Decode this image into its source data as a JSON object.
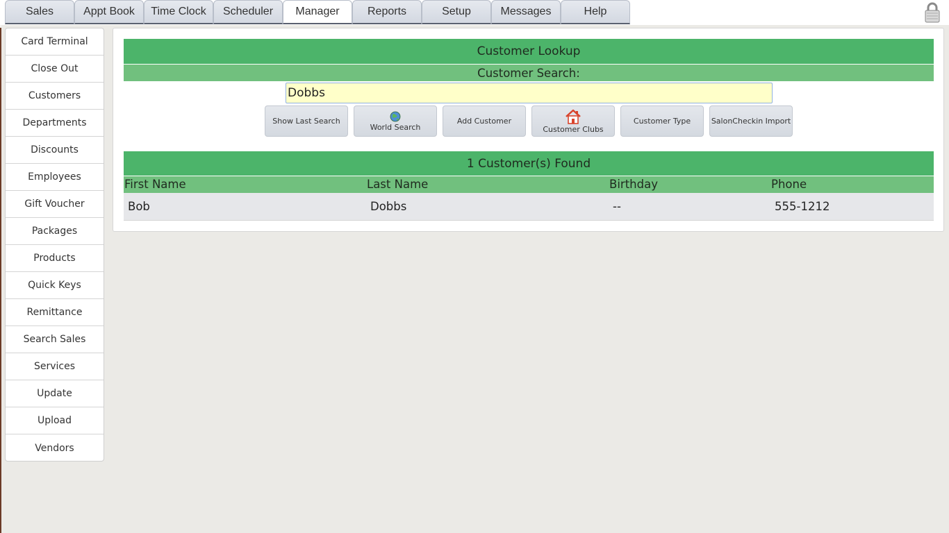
{
  "top_tabs": [
    {
      "label": "Sales",
      "active": false
    },
    {
      "label": "Appt Book",
      "active": false
    },
    {
      "label": "Time Clock",
      "active": false
    },
    {
      "label": "Scheduler",
      "active": false
    },
    {
      "label": "Manager",
      "active": true
    },
    {
      "label": "Reports",
      "active": false
    },
    {
      "label": "Setup",
      "active": false
    },
    {
      "label": "Messages",
      "active": false
    },
    {
      "label": "Help",
      "active": false
    }
  ],
  "lock_icon": "padlock-icon",
  "sidebar": {
    "items": [
      {
        "label": "Card Terminal"
      },
      {
        "label": "Close Out"
      },
      {
        "label": "Customers"
      },
      {
        "label": "Departments"
      },
      {
        "label": "Discounts"
      },
      {
        "label": "Employees"
      },
      {
        "label": "Gift Voucher"
      },
      {
        "label": "Packages"
      },
      {
        "label": "Products"
      },
      {
        "label": "Quick Keys"
      },
      {
        "label": "Remittance"
      },
      {
        "label": "Search Sales"
      },
      {
        "label": "Services"
      },
      {
        "label": "Update"
      },
      {
        "label": "Upload"
      },
      {
        "label": "Vendors"
      }
    ]
  },
  "lookup": {
    "title": "Customer Lookup",
    "search_label": "Customer Search:",
    "search_value": "Dobbs",
    "buttons": [
      {
        "label": "Show Last Search",
        "icon": ""
      },
      {
        "label": "World Search",
        "icon": "globe-icon"
      },
      {
        "label": "Add Customer",
        "icon": ""
      },
      {
        "label": "Customer Clubs",
        "icon": "house-icon"
      },
      {
        "label": "Customer Type",
        "icon": ""
      },
      {
        "label": "SalonCheckin Import",
        "icon": ""
      }
    ]
  },
  "results": {
    "title": "1 Customer(s) Found",
    "columns": [
      "First Name",
      "Last Name",
      "Birthday",
      "Phone"
    ],
    "rows": [
      {
        "first": "Bob",
        "last": "Dobbs",
        "birthday": "--",
        "phone": "555-1212"
      }
    ]
  },
  "colors": {
    "header_green": "#4cb46a",
    "subheader_green": "#71c07e",
    "search_bg": "#ffffc9",
    "row_bg": "#e6e7ea"
  }
}
